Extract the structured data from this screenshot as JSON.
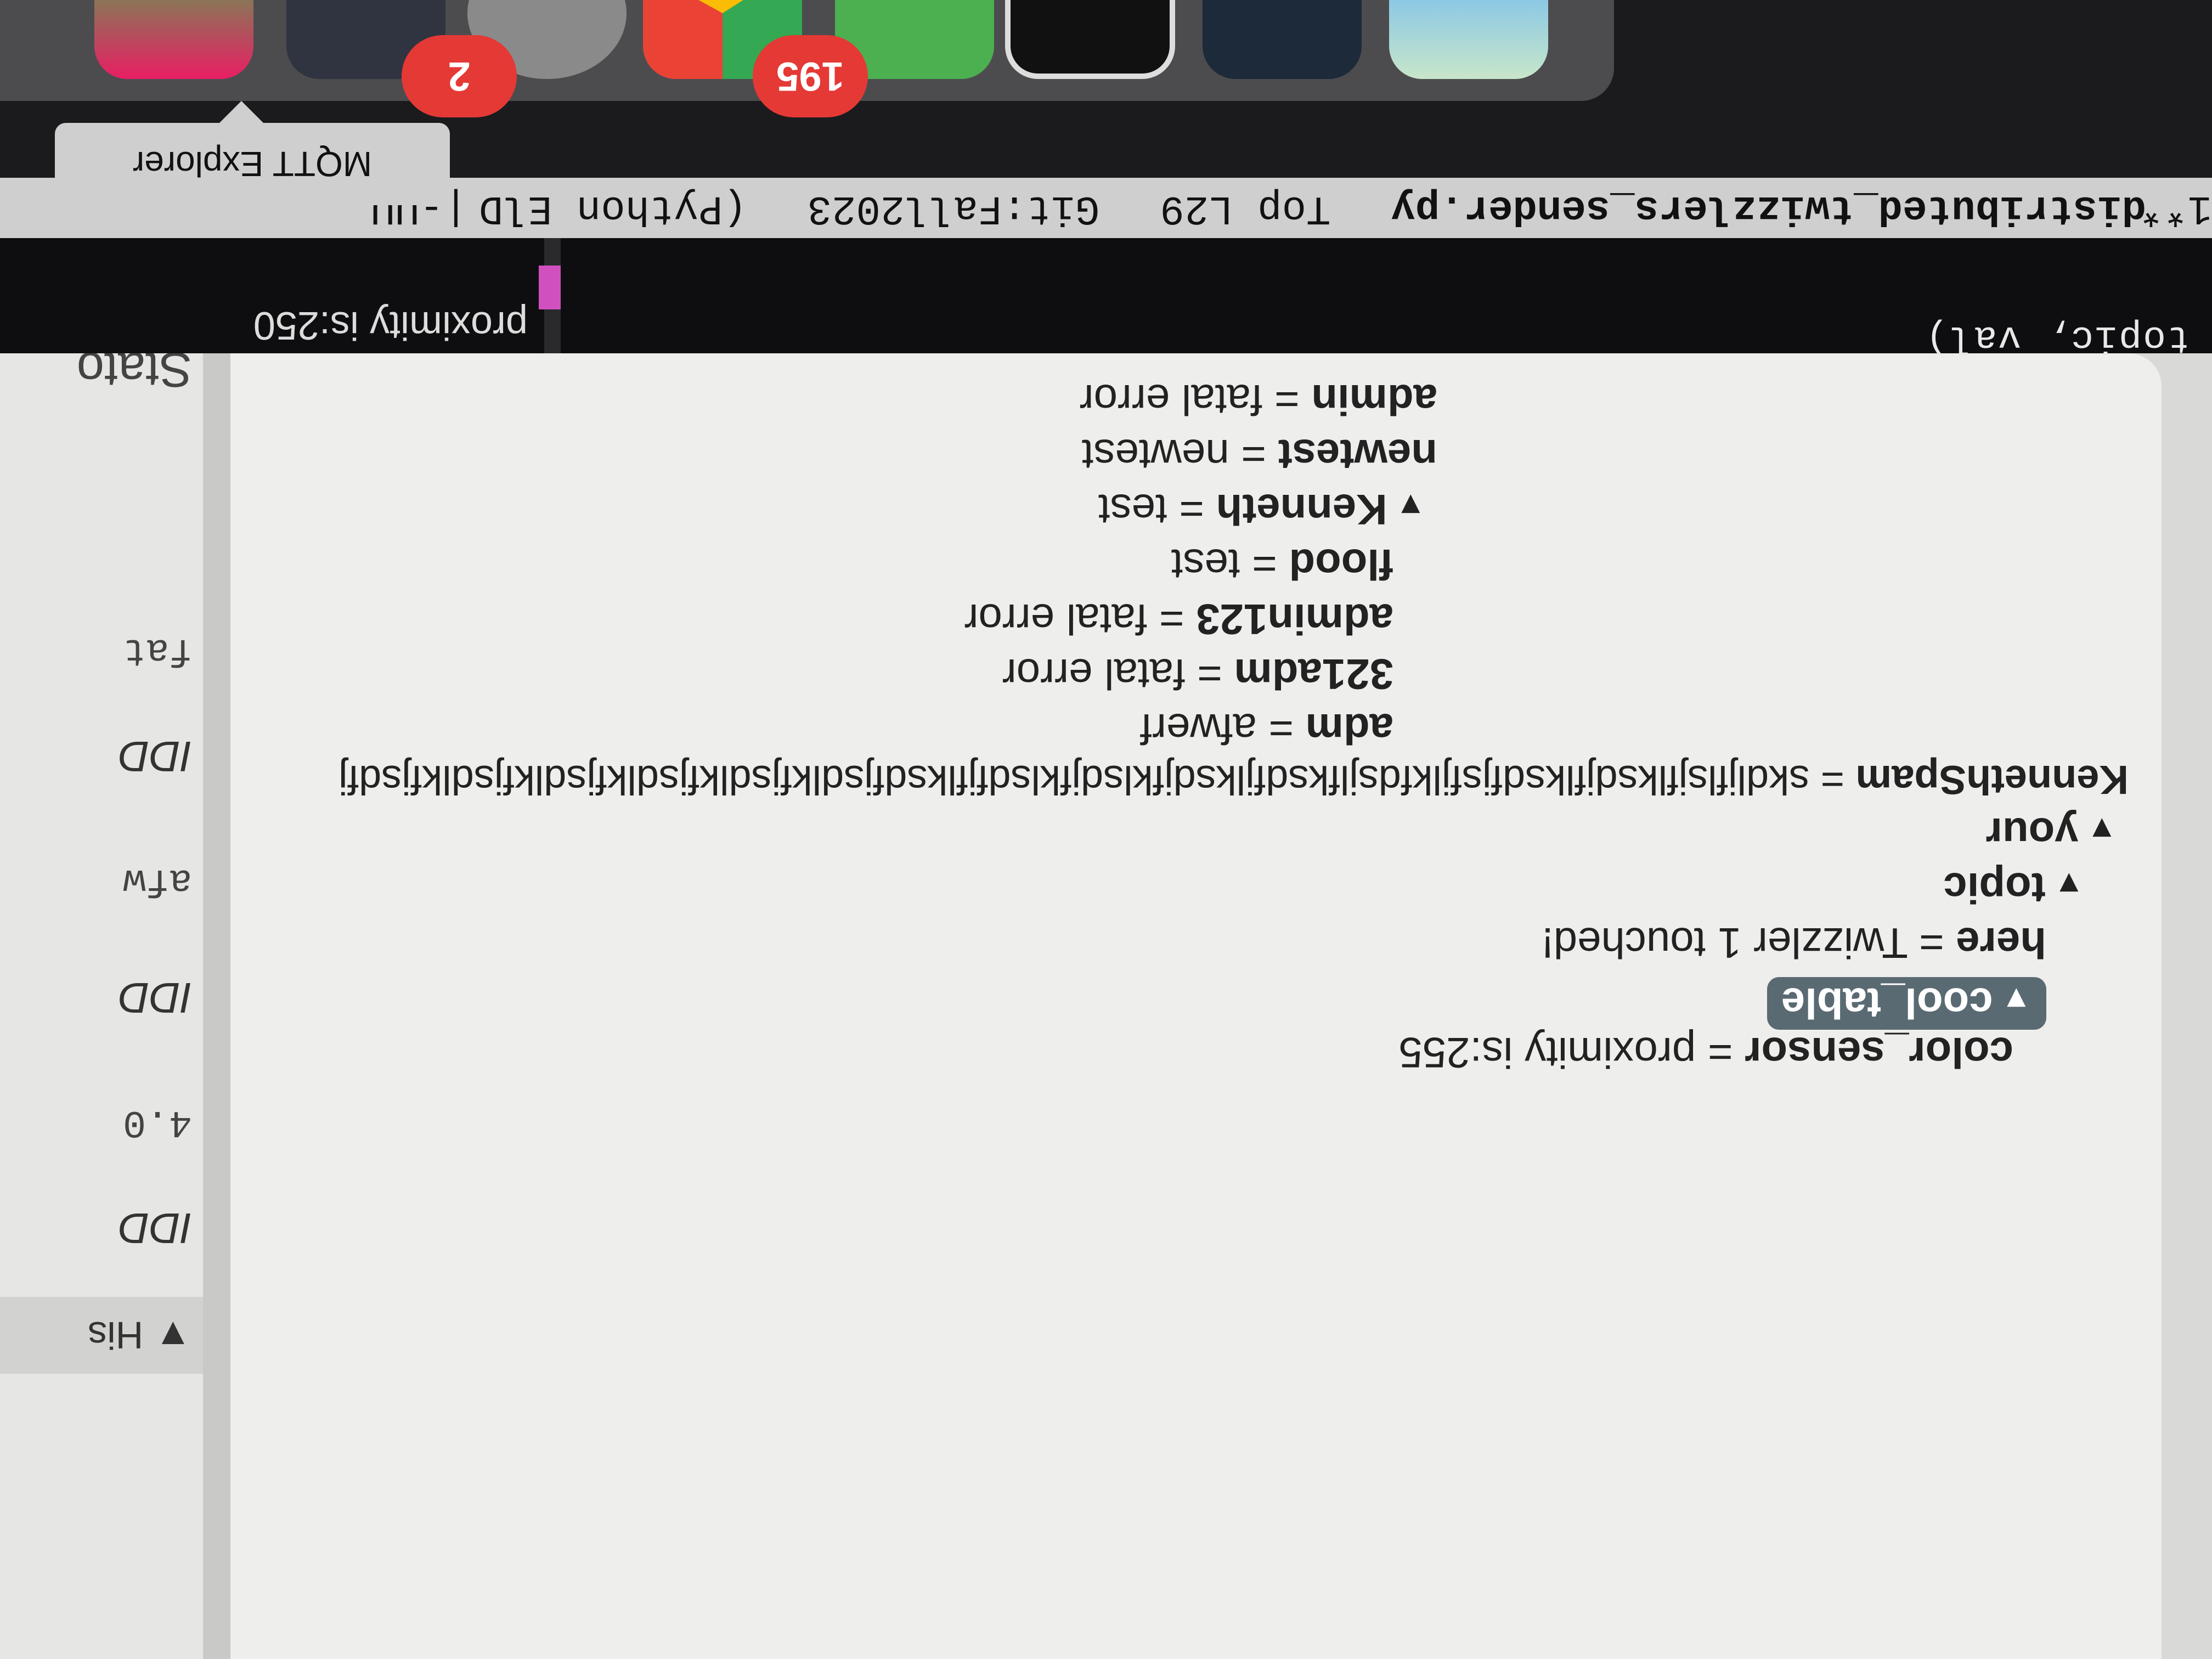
{
  "terminal": {
    "code_line": "topic, val)",
    "output_line": "proximity is:250",
    "mode_line": {
      "modified": "1**",
      "file": "distributed_twizzlers_sender.py",
      "position": "Top L29",
      "git": "Git:Fall2023",
      "mode": "(Python ElD",
      "tail": "|-UU"
    }
  },
  "tooltip": {
    "label": "MQTT Explorer"
  },
  "dock": {
    "badges": [
      "2",
      "195"
    ],
    "icons": [
      "slack-icon",
      "settings-icon",
      "tool-icon",
      "gear-icon",
      "chrome-icon",
      "messages-icon",
      "terminal-icon",
      "app-icon",
      "finder-icon"
    ]
  },
  "tree": {
    "nodes": [
      {
        "key": "admin",
        "value": "fatal error",
        "expanded": null
      },
      {
        "key": "newtest",
        "value": "newtest",
        "expanded": null
      },
      {
        "key": "Kenneth",
        "value": "test",
        "expanded": true
      },
      {
        "key": "flood",
        "value": "test",
        "expanded": null
      },
      {
        "key": "admin123",
        "value": "fatal error",
        "expanded": null
      },
      {
        "key": "321adm",
        "value": "fatal error",
        "expanded": null
      },
      {
        "key": "adm",
        "value": "afwerf",
        "expanded": null
      },
      {
        "key": "KennethSpam",
        "value": "skdljflsjflksdjflksdfjsfjlkfdsjlfksdfjlksdjfklsdjfklsdfjflksdfjsdlkfjsdlkfjsdlkfjsdlkfjsdlkfjsdfj",
        "expanded": null
      },
      {
        "key": "your",
        "value": "",
        "expanded": true
      },
      {
        "key": "topic",
        "value": "",
        "expanded": true
      },
      {
        "key": "here",
        "value": "Twizzler 1 touched!",
        "expanded": null
      },
      {
        "key": "cool_table",
        "value": "",
        "expanded": true,
        "selected": true
      },
      {
        "key": "color_sensor",
        "value": "proximity is:255",
        "expanded": null
      }
    ],
    "separator": "="
  },
  "right_pane": {
    "history_label": "His",
    "entries": [
      "IDD",
      "4.0",
      "IDD",
      "afw",
      "IDD",
      "fat"
    ],
    "value_label": "Stato"
  }
}
